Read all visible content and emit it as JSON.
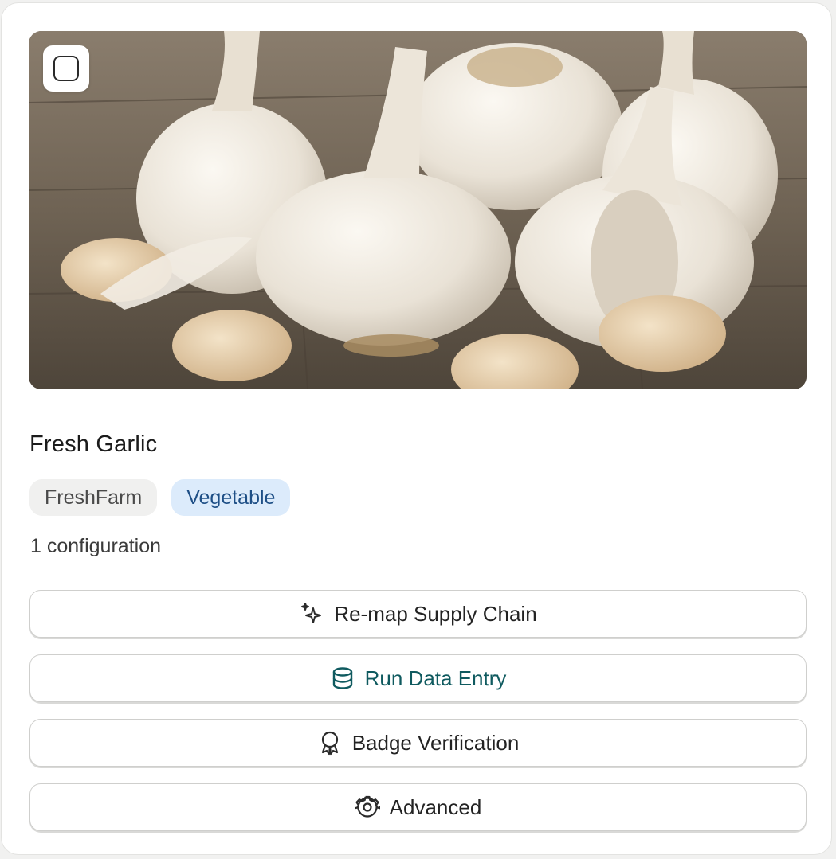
{
  "product": {
    "title": "Fresh Garlic",
    "tags": {
      "brand": "FreshFarm",
      "category": "Vegetable"
    },
    "configuration_count": "1 configuration",
    "image_subject": "garlic bulbs and cloves on wooden table"
  },
  "actions": {
    "remap_label": "Re-map Supply Chain",
    "remap_icon": "sparkles-icon",
    "run_label": "Run Data Entry",
    "run_icon": "database-icon",
    "badge_label": "Badge Verification",
    "badge_icon": "award-icon",
    "advanced_label": "Advanced",
    "advanced_icon": "gear-icon"
  },
  "colors": {
    "category_tag_bg": "#dcebfb",
    "category_tag_text": "#1e4f86",
    "run_accent": "#0f5a5f"
  }
}
